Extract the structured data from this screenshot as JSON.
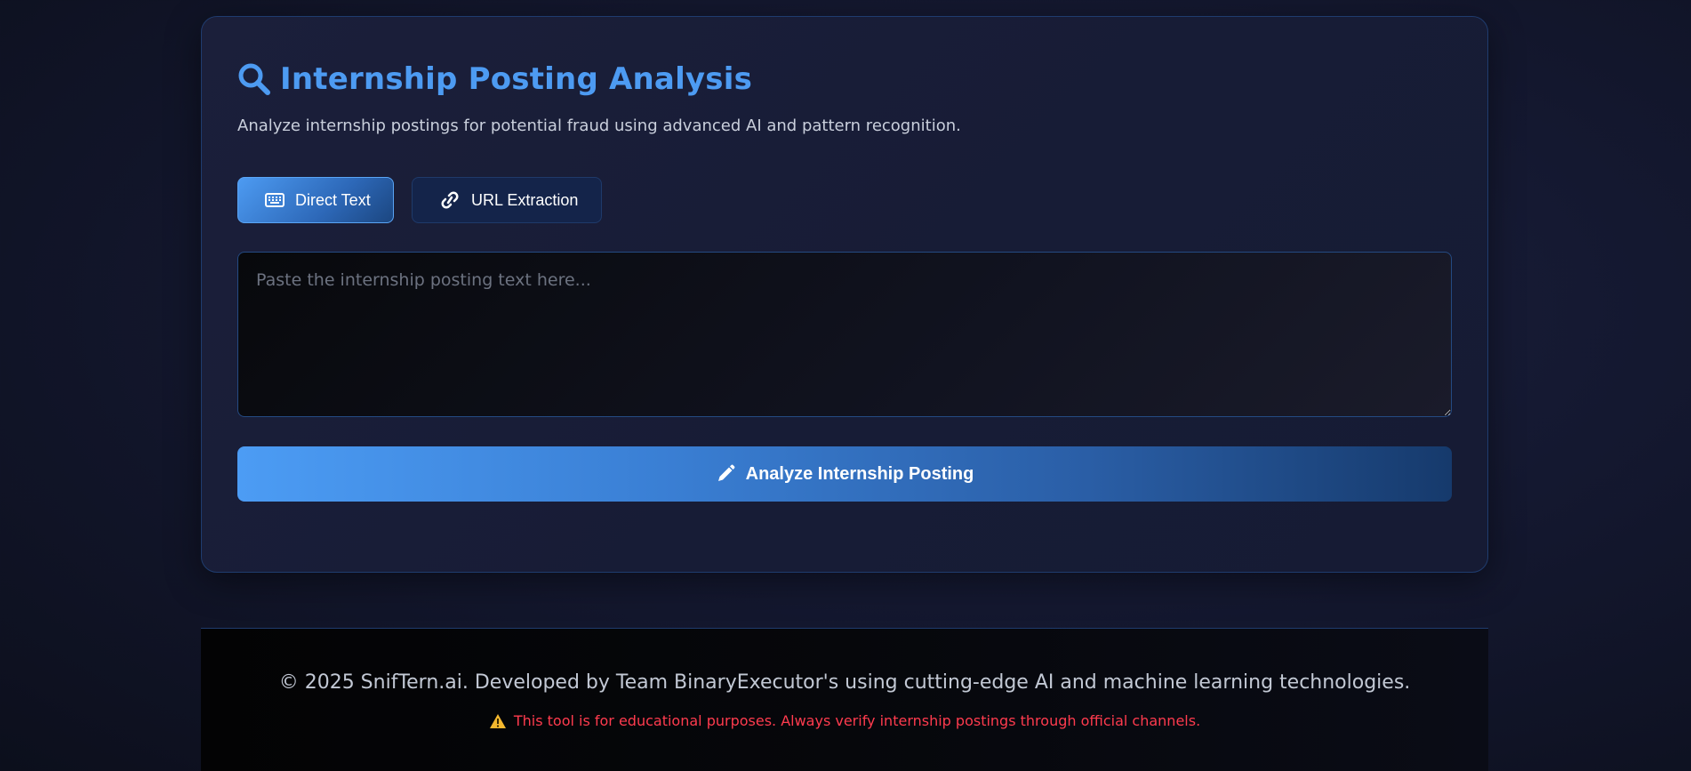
{
  "header": {
    "title": "Internship Posting Analysis",
    "title_icon": "search-icon",
    "subtitle": "Analyze internship postings for potential fraud using advanced AI and pattern recognition."
  },
  "tabs": [
    {
      "label": "Direct Text",
      "icon": "keyboard-icon",
      "active": true
    },
    {
      "label": "URL Extraction",
      "icon": "link-icon",
      "active": false
    }
  ],
  "input": {
    "placeholder": "Paste the internship posting text here...",
    "value": ""
  },
  "analyze_button": {
    "label": "Analyze Internship Posting",
    "icon": "pencil-icon"
  },
  "footer": {
    "copyright": "© 2025 SnifTern.ai. Developed by Team BinaryExecutor's using cutting-edge AI and machine learning technologies.",
    "warning": "This tool is for educational purposes. Always verify internship postings through official channels.",
    "warning_icon": "warning-icon"
  },
  "colors": {
    "accent": "#4d9bf2",
    "warning": "#ff3b4e",
    "card_border": "#1f3c6e"
  }
}
